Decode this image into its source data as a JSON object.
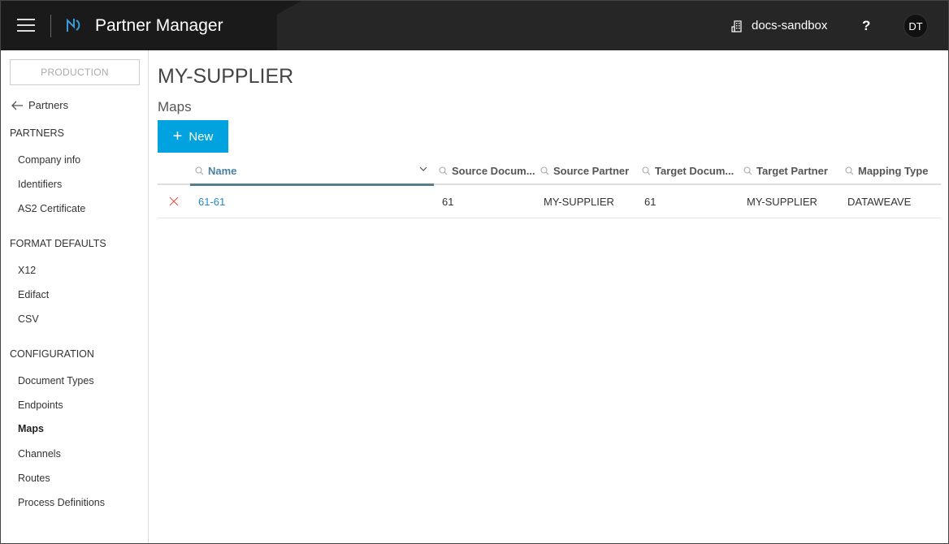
{
  "header": {
    "app_title": "Partner Manager",
    "environment": "docs-sandbox",
    "help": "?",
    "user_initials": "DT"
  },
  "sidebar": {
    "env_badge": "PRODUCTION",
    "back_label": "Partners",
    "sections": [
      {
        "title": "PARTNERS",
        "items": [
          "Company info",
          "Identifiers",
          "AS2 Certificate"
        ]
      },
      {
        "title": "FORMAT DEFAULTS",
        "items": [
          "X12",
          "Edifact",
          "CSV"
        ]
      },
      {
        "title": "CONFIGURATION",
        "items": [
          "Document Types",
          "Endpoints",
          "Maps",
          "Channels",
          "Routes",
          "Process Definitions"
        ]
      }
    ],
    "active_item": "Maps"
  },
  "main": {
    "page_title": "MY-SUPPLIER",
    "section_title": "Maps",
    "new_button": "New",
    "columns": [
      "Name",
      "Source Docum...",
      "Source Partner",
      "Target Docum...",
      "Target Partner",
      "Mapping Type"
    ],
    "rows": [
      [
        "61-61",
        "61",
        "MY-SUPPLIER",
        "61",
        "MY-SUPPLIER",
        "DATAWEAVE"
      ]
    ]
  },
  "colors": {
    "header_bg": "#262626",
    "accent": "#00a2df",
    "link": "#1f8cc7",
    "delete": "#e05a4e"
  }
}
